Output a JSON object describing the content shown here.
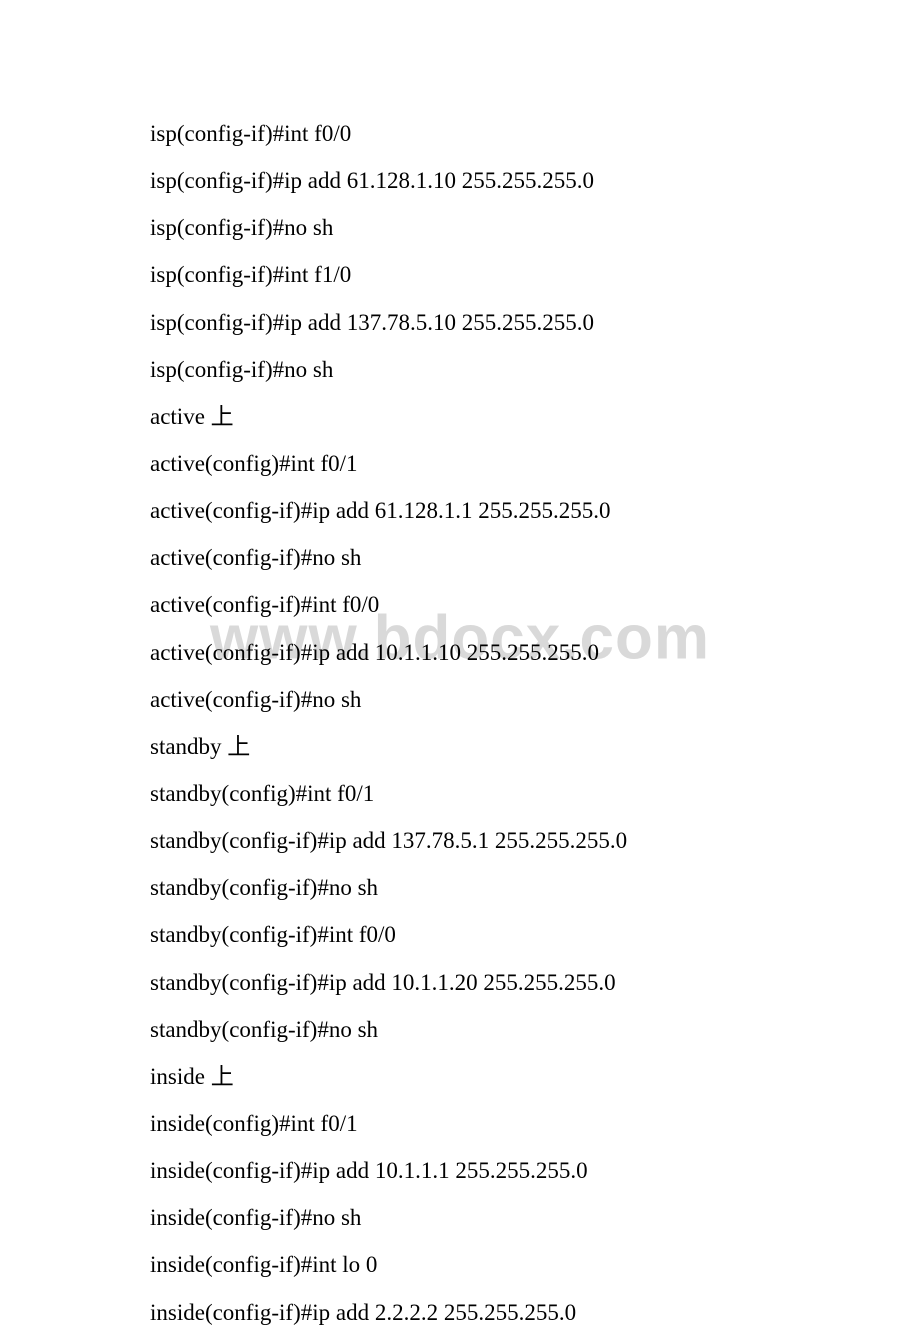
{
  "watermark": "www.bdocx.com",
  "lines": [
    "isp(config-if)#int f0/0",
    "isp(config-if)#ip add 61.128.1.10 255.255.255.0",
    "isp(config-if)#no sh",
    "isp(config-if)#int f1/0",
    "isp(config-if)#ip add 137.78.5.10 255.255.255.0",
    "isp(config-if)#no sh",
    "active 上",
    "active(config)#int f0/1",
    "active(config-if)#ip add 61.128.1.1 255.255.255.0",
    "active(config-if)#no sh",
    "active(config-if)#int f0/0",
    "active(config-if)#ip add 10.1.1.10 255.255.255.0",
    "active(config-if)#no sh",
    "standby 上",
    "standby(config)#int f0/1",
    "standby(config-if)#ip add 137.78.5.1 255.255.255.0",
    "standby(config-if)#no sh",
    "standby(config-if)#int f0/0",
    "standby(config-if)#ip add 10.1.1.20 255.255.255.0",
    "standby(config-if)#no sh",
    "inside 上",
    "inside(config)#int f0/1",
    "inside(config-if)#ip add 10.1.1.1 255.255.255.0",
    "inside(config-if)#no sh",
    "inside(config-if)#int lo 0",
    "inside(config-if)#ip add 2.2.2.2 255.255.255.0"
  ]
}
